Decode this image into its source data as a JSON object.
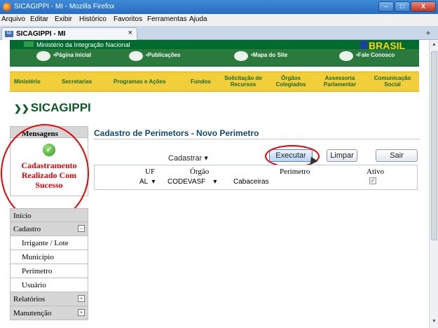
{
  "window": {
    "title": "SICAGIPPI - MI - Mozilla Firefox",
    "min": "–",
    "max": "□",
    "close": "X"
  },
  "menubar": [
    "Arquivo",
    "Editar",
    "Exibir",
    "Histórico",
    "Favoritos",
    "Ferramentas",
    "Ajuda"
  ],
  "tab": {
    "title": "SICAGIPPI - MI",
    "close": "×",
    "new_tab": "+"
  },
  "gov": {
    "ministry": "Ministério da Integração Nacional",
    "logo": "BRASIL",
    "links": [
      "•Página Inicial",
      "•Publicações",
      "•Mapa do Site",
      "•Fale Conosco"
    ]
  },
  "nav": [
    "Ministério",
    "Secretarias",
    "Programas e Ações",
    "Fundos",
    "Solicitação de Recursos",
    "Órgãos Colegiados",
    "Assessoria Parlamentar",
    "Comunicação Social"
  ],
  "brand": "SICAGIPPI",
  "messages": {
    "title": "Mensagens",
    "text": "Cadastramento Realizado Com Sucesso"
  },
  "sidebar": {
    "items": [
      {
        "label": "Início",
        "type": "top",
        "toggle": ""
      },
      {
        "label": "Cadastro",
        "type": "top",
        "toggle": "−"
      },
      {
        "label": "Irrigante / Lote",
        "type": "sub",
        "toggle": ""
      },
      {
        "label": "Município",
        "type": "sub",
        "toggle": ""
      },
      {
        "label": "Perímetro",
        "type": "sub",
        "toggle": ""
      },
      {
        "label": "Usuário",
        "type": "sub",
        "toggle": ""
      },
      {
        "label": "Relatórios",
        "type": "top",
        "toggle": "+"
      },
      {
        "label": "Manutenção",
        "type": "top",
        "toggle": "+"
      }
    ]
  },
  "form": {
    "title": "Cadastro de Perimetors - Novo Perimetro",
    "dropdown": "Cadastrar ▾",
    "buttons": {
      "executar": "Executar",
      "limpar": "Limpar",
      "sair": "Sair"
    },
    "headers": {
      "uf": "UF",
      "orgao": "Órgão",
      "perimetro": "Perímetro",
      "ativo": "Ativo"
    },
    "values": {
      "uf": "AL",
      "orgao": "CODEVASF",
      "perimetro": "Cabaceiras",
      "ativo_mark": "✓"
    }
  }
}
